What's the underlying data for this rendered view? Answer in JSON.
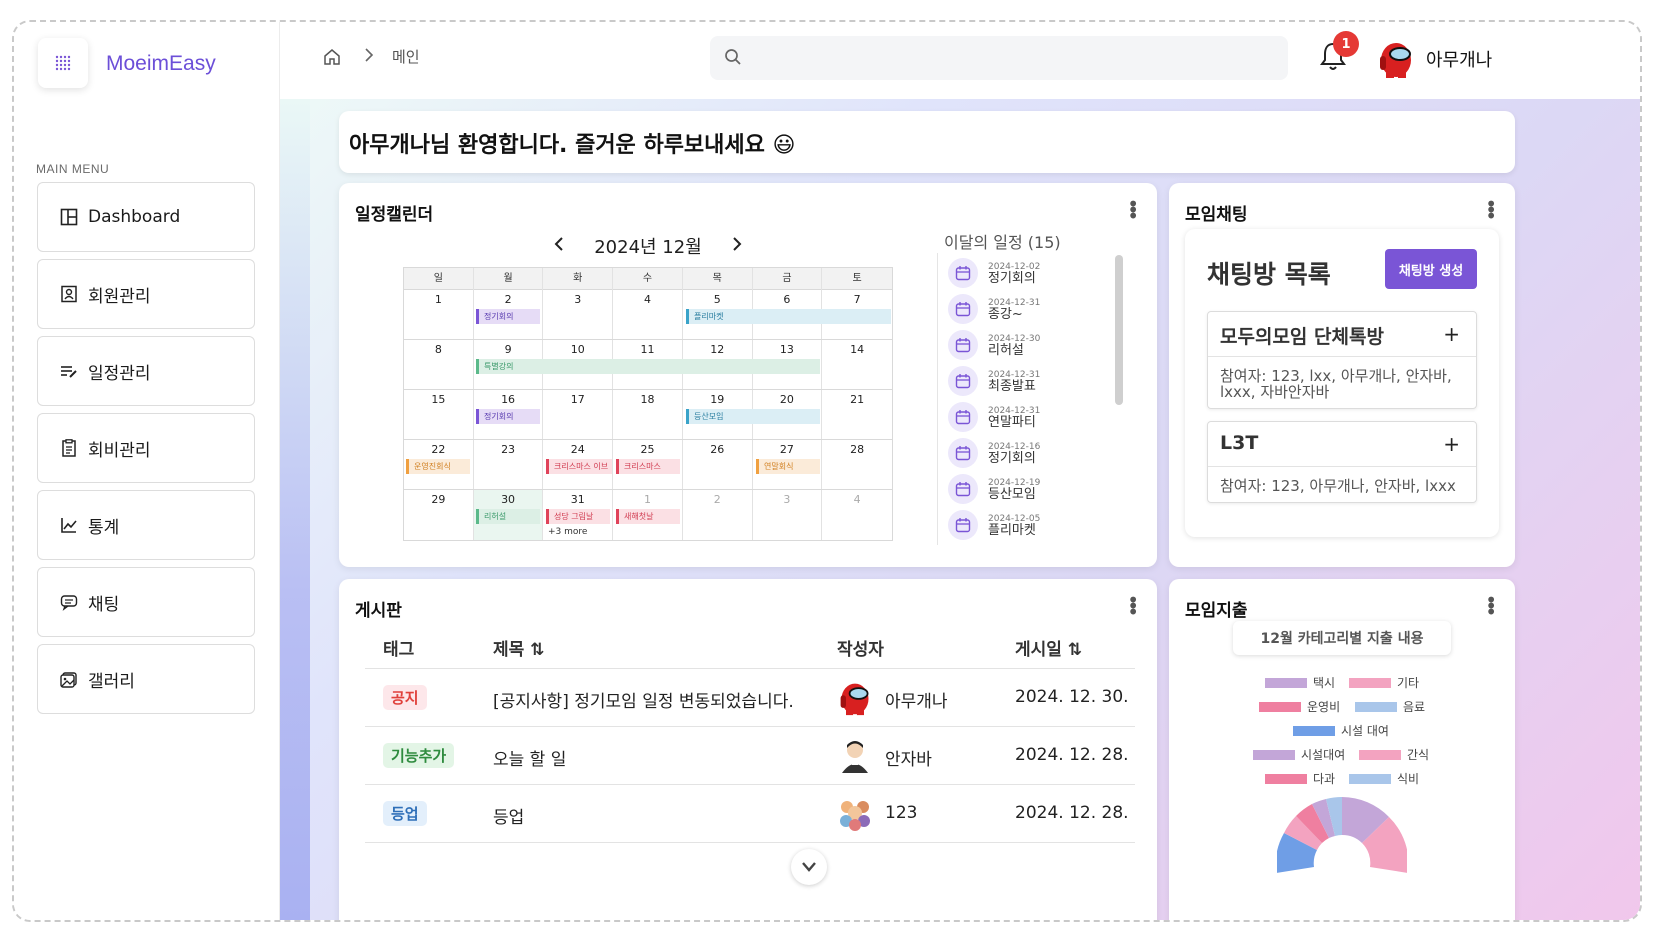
{
  "app": {
    "name": "MoeimEasy"
  },
  "sidebar": {
    "menu_title": "MAIN MENU",
    "items": [
      {
        "label": "Dashboard",
        "icon": "dashboard-icon"
      },
      {
        "label": "회원관리",
        "icon": "member-icon"
      },
      {
        "label": "일정관리",
        "icon": "schedule-icon"
      },
      {
        "label": "회비관리",
        "icon": "fee-icon"
      },
      {
        "label": "통계",
        "icon": "chart-icon"
      },
      {
        "label": "채팅",
        "icon": "chat-icon"
      },
      {
        "label": "갤러리",
        "icon": "gallery-icon"
      }
    ]
  },
  "topbar": {
    "breadcrumb": "메인",
    "search_placeholder": "",
    "notification_count": "1",
    "user_name": "아무개나"
  },
  "welcome": {
    "text": "아무개나님 환영합니다. 즐거운 하루보내세요 😃"
  },
  "calendar": {
    "title": "일정캘린더",
    "month_label": "2024년 12월",
    "weekdays": [
      "일",
      "월",
      "화",
      "수",
      "목",
      "금",
      "토"
    ],
    "weeks": [
      [
        "1",
        "2",
        "3",
        "4",
        "5",
        "6",
        "7"
      ],
      [
        "8",
        "9",
        "10",
        "11",
        "12",
        "13",
        "14"
      ],
      [
        "15",
        "16",
        "17",
        "18",
        "19",
        "20",
        "21"
      ],
      [
        "22",
        "23",
        "24",
        "25",
        "26",
        "27",
        "28"
      ],
      [
        "29",
        "30",
        "31",
        "1",
        "2",
        "3",
        "4"
      ]
    ],
    "events": {
      "e1": "정기회의",
      "e2": "플리마켓",
      "e3": "특별강의",
      "e4": "정기회의",
      "e5": "등산모임",
      "e6": "운영진회식",
      "e7": "크리스마스 이브",
      "e8": "크리스마스",
      "e9": "연말회식",
      "e10": "리허설",
      "e11": "성당 그림날",
      "e12": "새해첫날",
      "more": "+3 more"
    },
    "schedule_title": "이달의 일정 (15)",
    "schedule": [
      {
        "date": "2024-12-02",
        "name": "정기회의"
      },
      {
        "date": "2024-12-31",
        "name": "종강~"
      },
      {
        "date": "2024-12-30",
        "name": "리허설"
      },
      {
        "date": "2024-12-31",
        "name": "최종발표"
      },
      {
        "date": "2024-12-31",
        "name": "연말파티"
      },
      {
        "date": "2024-12-16",
        "name": "정기회의"
      },
      {
        "date": "2024-12-19",
        "name": "등산모임"
      },
      {
        "date": "2024-12-05",
        "name": "플리마켓"
      }
    ]
  },
  "chat": {
    "title": "모임채팅",
    "heading": "채팅방 목록",
    "create_label": "채팅방 생성",
    "rooms": [
      {
        "name": "모두의모임 단체톡방",
        "members_1": "참여자: 123, lxx, 아무개나, 안자바,",
        "members_2": "lxxx, 자바안자바"
      },
      {
        "name": "L3T",
        "members_1": "참여자: 123, 아무개나, 안자바, lxxx",
        "members_2": ""
      }
    ]
  },
  "board": {
    "title": "게시판",
    "headers": {
      "tag": "태그",
      "title": "제목 ⇅",
      "author": "작성자",
      "date": "게시일 ⇅"
    },
    "rows": [
      {
        "tag": "공지",
        "title": "[공지사항] 정기모임 일정 변동되었습니다.",
        "author": "아무개나",
        "date": "2024. 12. 30."
      },
      {
        "tag": "기능추가",
        "title": "오늘 할 일",
        "author": "안자바",
        "date": "2024. 12. 28."
      },
      {
        "tag": "등업",
        "title": "등업",
        "author": "123",
        "date": "2024. 12. 28."
      }
    ]
  },
  "expense": {
    "title": "모임지출",
    "chart_title": "12월 카테고리별 지출 내용",
    "legend": [
      {
        "label": "택시",
        "color": "#c3a6d8"
      },
      {
        "label": "기타",
        "color": "#f3a3c0"
      },
      {
        "label": "운영비",
        "color": "#ef7fa0"
      },
      {
        "label": "음료",
        "color": "#a9c6ea"
      },
      {
        "label": "시설 대여",
        "color": "#6f9ee6"
      },
      {
        "label": "시설대여",
        "color": "#c3a6d8"
      },
      {
        "label": "간식",
        "color": "#f3a3c0"
      },
      {
        "label": "다과",
        "color": "#ef7fa0"
      },
      {
        "label": "식비",
        "color": "#a9c6ea"
      }
    ]
  },
  "colors": {
    "accent": "#7a55d6",
    "brand_text": "#6c4fd8",
    "notice_bg": "#fde7ea",
    "notice_fg": "#e0413c",
    "feature_bg": "#e3f5e6",
    "feature_fg": "#2e8b3e",
    "levelup_bg": "#e3effb",
    "levelup_fg": "#2f6fb8"
  }
}
